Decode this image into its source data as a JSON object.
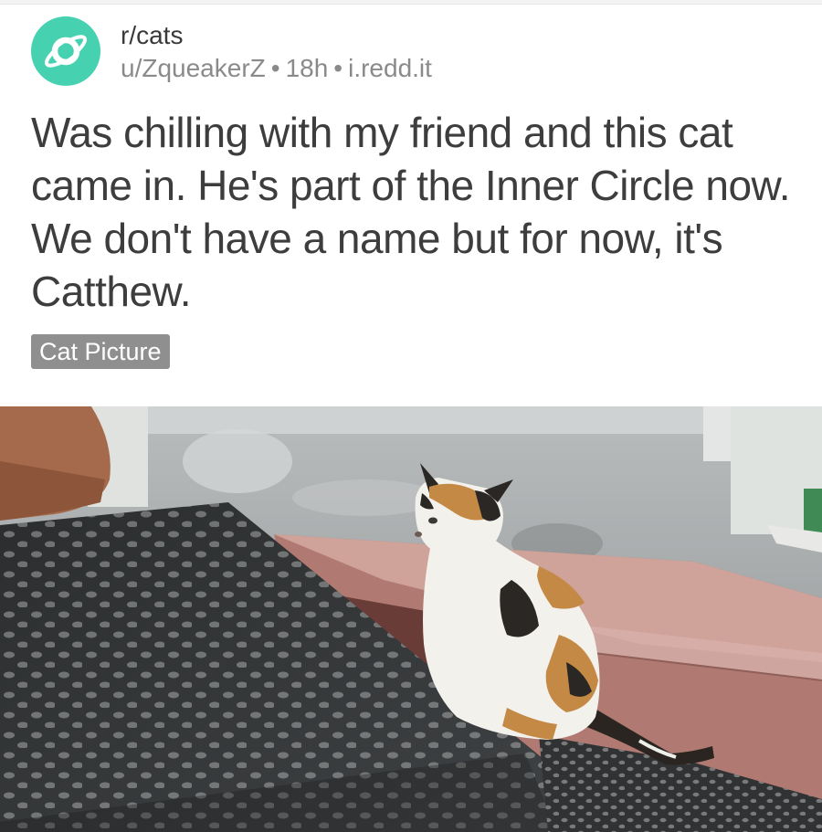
{
  "post": {
    "subreddit": "r/cats",
    "author": "u/ZqueakerZ",
    "age": "18h",
    "domain": "i.redd.it",
    "separator": "•",
    "title": "Was chilling with my friend and this cat came in. He's part of the Inner Circle now. We don't have a name but for now, it's Catthew.",
    "flair": "Cat Picture"
  },
  "icons": {
    "community_avatar": "planet-icon"
  },
  "colors": {
    "avatar": "#46d2b0",
    "flair_bg": "#8f8f8f",
    "title_text": "#3d3d3d",
    "meta_text": "#8a8a8a"
  }
}
